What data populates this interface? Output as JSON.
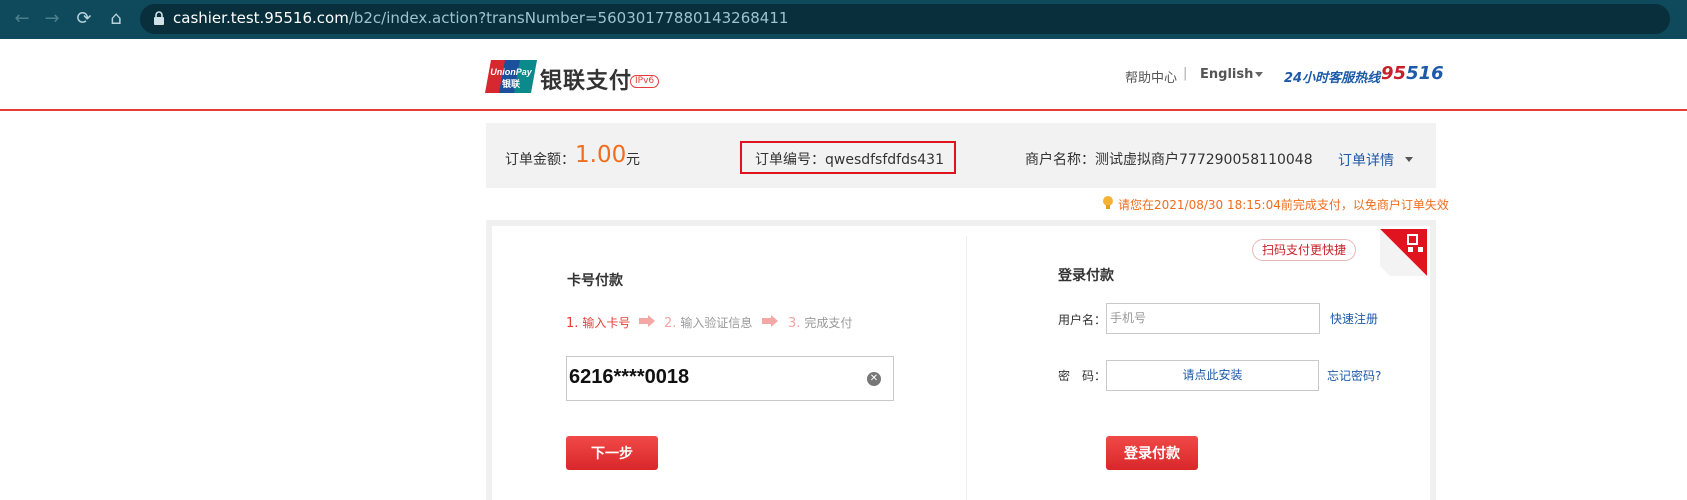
{
  "browser": {
    "back_icon": "arrow-left-icon",
    "forward_icon": "arrow-right-icon",
    "reload_icon": "reload-icon",
    "home_icon": "home-icon",
    "url_host": "cashier.test.95516.com",
    "url_path": "/b2c/index.action?transNumber=560301778801432684​11"
  },
  "header": {
    "logo_text": "UnionPay 银联",
    "brand": "银联支付",
    "ipv6": "IPv6",
    "help": "帮助中心",
    "separator": "|",
    "language": "English",
    "hotline_label": "24小时客服热线",
    "hotline_num_a": "95",
    "hotline_num_b": "516"
  },
  "order": {
    "amount_label": "订单金额：",
    "amount": "1.00",
    "currency": "元",
    "order_no": "订单编号：qwesdfsfdfds431",
    "merchant": "商户名称：测试虚拟商户777290058110048",
    "detail": "订单详情"
  },
  "deadline": "请您在2021/08/30 18:15:04前完成支付，以免商户订单失效",
  "card_pay": {
    "title": "卡号付款",
    "steps": [
      {
        "n": "1.",
        "label": "输入卡号"
      },
      {
        "n": "2.",
        "label": "输入验证信息"
      },
      {
        "n": "3.",
        "label": "完成支付"
      }
    ],
    "card_value": "6216****0018",
    "next": "下一步"
  },
  "login_pay": {
    "title": "登录付款",
    "user_label": "用户名：",
    "user_placeholder": "手机号",
    "register": "快速注册",
    "pwd_label": "密　码：",
    "pwd_install": "请点此安装",
    "forgot": "忘记密码?",
    "login": "登录付款"
  },
  "promo": "扫码支付更快捷",
  "colors": {
    "brand_red": "#e53e3a",
    "link_blue": "#1e5aa8",
    "amount_orange": "#f06d1e",
    "browser_bar": "#0e4a5c"
  }
}
